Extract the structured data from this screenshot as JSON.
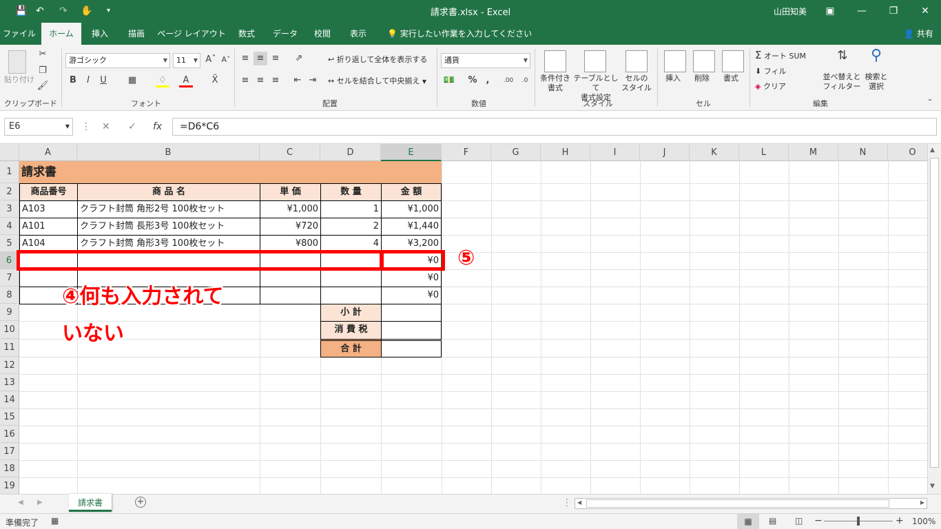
{
  "titlebar": {
    "title": "請求書.xlsx  -  Excel",
    "user": "山田知美",
    "save_icon": "save-icon",
    "undo_icon": "undo-icon",
    "redo_icon": "redo-icon",
    "touch_icon": "touch-mode-icon",
    "customize_icon": "customize-qat-icon"
  },
  "tabs": [
    "ファイル",
    "ホーム",
    "挿入",
    "描画",
    "ページ レイアウト",
    "数式",
    "データ",
    "校閲",
    "表示"
  ],
  "tellme": "実行したい作業を入力してください",
  "share": "共有",
  "ribbon": {
    "clipboard": {
      "label": "クリップボード",
      "paste": "貼り付け"
    },
    "font": {
      "label": "フォント",
      "font_name": "游ゴシック",
      "font_size": "11"
    },
    "alignment": {
      "label": "配置",
      "wrap": "折り返して全体を表示する",
      "merge": "セルを結合して中央揃え"
    },
    "number": {
      "label": "数値",
      "format": "通貨"
    },
    "styles": {
      "label": "スタイル",
      "cond_1": "条件付き",
      "cond_2": "書式",
      "table_1": "テーブルとして",
      "table_2": "書式設定",
      "cell_1": "セルの",
      "cell_2": "スタイル"
    },
    "cells": {
      "label": "セル",
      "insert": "挿入",
      "delete": "削除",
      "format": "書式"
    },
    "editing": {
      "label": "編集",
      "autosum": "オート SUM",
      "fill": "フィル",
      "clear": "クリア",
      "sort_1": "並べ替えと",
      "sort_2": "フィルター",
      "find_1": "検索と",
      "find_2": "選択"
    }
  },
  "formula": {
    "namebox": "E6",
    "content": "=D6*C6"
  },
  "columns": [
    "A",
    "B",
    "C",
    "D",
    "E",
    "F",
    "G",
    "H",
    "I",
    "J",
    "K",
    "L",
    "M",
    "N",
    "O"
  ],
  "rows": [
    "1",
    "2",
    "3",
    "4",
    "5",
    "6",
    "7",
    "8",
    "9",
    "10",
    "11",
    "12",
    "13",
    "14",
    "15",
    "16",
    "17",
    "18",
    "19"
  ],
  "sheet": {
    "title": "請求書",
    "headers": {
      "code": "商品番号",
      "name": "商 品 名",
      "price": "単 価",
      "qty": "数 量",
      "amount": "金 額"
    },
    "items": [
      {
        "code": "A103",
        "name": "クラフト封筒 角形2号 100枚セット",
        "price": "¥1,000",
        "qty": "1",
        "amount": "¥1,000"
      },
      {
        "code": "A101",
        "name": "クラフト封筒 長形3号 100枚セット",
        "price": "¥720",
        "qty": "2",
        "amount": "¥1,440"
      },
      {
        "code": "A104",
        "name": "クラフト封筒 角形3号 100枚セット",
        "price": "¥800",
        "qty": "4",
        "amount": "¥3,200"
      },
      {
        "code": "",
        "name": "",
        "price": "",
        "qty": "",
        "amount": "¥0"
      },
      {
        "code": "",
        "name": "",
        "price": "",
        "qty": "",
        "amount": "¥0"
      },
      {
        "code": "",
        "name": "",
        "price": "",
        "qty": "",
        "amount": "¥0"
      }
    ],
    "subtotal": "小 計",
    "tax": "消 費 税",
    "total": "合 計"
  },
  "annotations": {
    "num5": "⑤",
    "note_line1": "④何も入力されて",
    "note_line2": "いない"
  },
  "sheettab": "請求書",
  "status": {
    "ready": "準備完了",
    "zoom": "100%"
  },
  "colors": {
    "excel_green": "#217346",
    "header_fill": "#fbe4d5",
    "title_fill": "#f4b183",
    "total_fill": "#f4b183",
    "annotation_red": "#ff0000"
  }
}
